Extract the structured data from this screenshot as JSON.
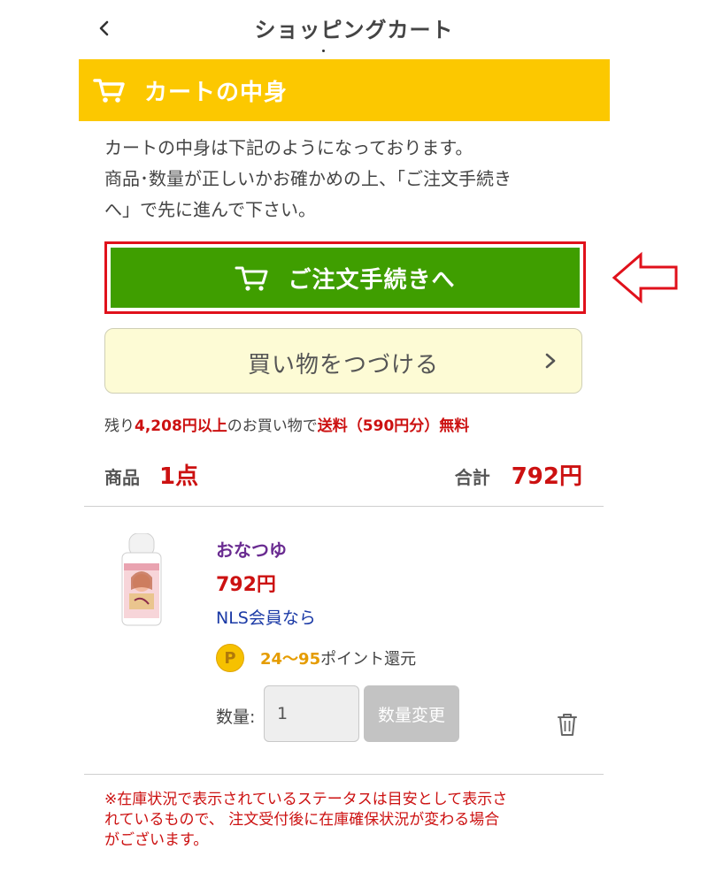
{
  "header": {
    "title": "ショッピングカート"
  },
  "cart_section": {
    "title": "カートの中身"
  },
  "intro": {
    "line1": "カートの中身は下記のようになっております。",
    "line2": "商品･数量が正しいかお確かめの上、「ご注文手続き",
    "line3": "へ」で先に進んで下さい。"
  },
  "buttons": {
    "order": "ご注文手続きへ",
    "continue": "買い物をつづける"
  },
  "shipping": {
    "prefix": "残り",
    "amount": "4,208円以上",
    "middle": "のお買い物で",
    "label": "送料（590円分）無料"
  },
  "summary": {
    "items_label": "商品",
    "items_count": "1点",
    "total_label": "合計",
    "total_value": "792円"
  },
  "product": {
    "name": "おなつゆ",
    "price": "792円",
    "member_text": "NLS会員なら",
    "points_icon_letter": "P",
    "points_range": "24〜95",
    "points_suffix": "ポイント還元",
    "quantity_label": "数量:",
    "quantity_value": "1",
    "update_label": "数量変更"
  },
  "note": {
    "line1": "※在庫状況で表示されているステータスは目安として表示さ",
    "line2": "れているもので、 注文受付後に在庫確保状況が変わる場合",
    "line3": "がございます。"
  },
  "colors": {
    "cart_bar": "#fcc800",
    "order_button": "#3f9e00",
    "highlight_border": "#e0111b",
    "continue_button": "#fdfbd5",
    "price_red": "#cc1111",
    "product_name": "#6a2c91",
    "member_link": "#1b3aa6",
    "points_orange": "#e59c00"
  },
  "icons": {
    "back": "chevron-left-icon",
    "cart": "cart-icon",
    "arrow": "left-arrow-outline-icon",
    "continue": "chevron-right-icon",
    "points": "point-coin-icon",
    "trash": "trash-icon"
  }
}
